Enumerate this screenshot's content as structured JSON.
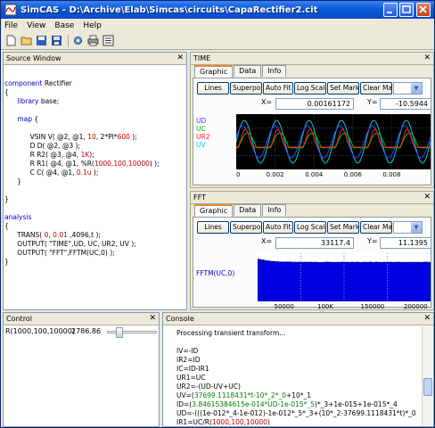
{
  "window": {
    "title": "SimCAS - D:\\Archive\\Elab\\Simcas\\circuits\\CapaRectifier2.cit",
    "controls": [
      "minimize",
      "maximize",
      "close"
    ]
  },
  "menu": [
    "File",
    "View",
    "Base",
    "Help"
  ],
  "toolbar": [
    "new-file-icon",
    "open-icon",
    "save-icon",
    "save-all-icon",
    "settings-icon",
    "print-icon",
    "list-icon"
  ],
  "source_window": {
    "title": "Source Window",
    "lines": [
      [
        {
          "t": "component ",
          "c": "kw"
        },
        {
          "t": "Rectifier"
        }
      ],
      [
        {
          "t": "{"
        }
      ],
      [
        {
          "t": "      "
        },
        {
          "t": "library ",
          "c": "kw"
        },
        {
          "t": "base;"
        }
      ],
      [
        {
          "t": ""
        }
      ],
      [
        {
          "t": "      "
        },
        {
          "t": "map ",
          "c": "kw"
        },
        {
          "t": "{"
        }
      ],
      [
        {
          "t": ""
        }
      ],
      [
        {
          "t": "            VSIN V( @2, @1, "
        },
        {
          "t": "10",
          "c": "nm"
        },
        {
          "t": ", 2*PI*"
        },
        {
          "t": "600",
          "c": "nm"
        },
        {
          "t": " );"
        }
      ],
      [
        {
          "t": "            D D( @2, @3 );"
        }
      ],
      [
        {
          "t": "            R R2( @3, @4, "
        },
        {
          "t": "1K",
          "c": "nm"
        },
        {
          "t": ");"
        }
      ],
      [
        {
          "t": "            R R1( @4, @1, %R("
        },
        {
          "t": "1000,100,10000",
          "c": "nm"
        },
        {
          "t": ") );"
        }
      ],
      [
        {
          "t": "            C C( @4, @1, "
        },
        {
          "t": "0.1u",
          "c": "nm"
        },
        {
          "t": " );"
        }
      ],
      [
        {
          "t": "      }"
        }
      ],
      [
        {
          "t": ""
        }
      ],
      [
        {
          "t": "}"
        }
      ],
      [
        {
          "t": ""
        }
      ],
      [
        {
          "t": "analysis",
          "c": "kw"
        }
      ],
      [
        {
          "t": "{"
        }
      ],
      [
        {
          "t": "      TRANS( "
        },
        {
          "t": "0",
          "c": "nm"
        },
        {
          "t": ", "
        },
        {
          "t": "0.01",
          "c": "nm"
        },
        {
          "t": " ,4096,t );"
        }
      ],
      [
        {
          "t": "      OUTPUT( \"TIME\",UD, UC, UR2, UV );"
        }
      ],
      [
        {
          "t": "      OUTPUT( \"FFT\",FFTM(UC,0) );"
        }
      ],
      [
        {
          "t": "}"
        }
      ]
    ]
  },
  "time_panel": {
    "title": "TIME",
    "tabs": [
      "Graphic",
      "Data",
      "Info"
    ],
    "active_tab": "Graphic",
    "buttons": [
      "Lines",
      "Superpose",
      "Auto Fit",
      "Log Scale",
      "Set Marker",
      "Clear Marker"
    ],
    "x_label": "X=",
    "x_value": "0.00161172",
    "y_label": "Y=",
    "y_value": "-10.5944",
    "legend": [
      {
        "name": "UD",
        "color": "#4040ff"
      },
      {
        "name": "UC",
        "color": "#00c000"
      },
      {
        "name": "UR2",
        "color": "#ff2020"
      },
      {
        "name": "UV",
        "color": "#00d0d0"
      }
    ],
    "x_ticks": [
      "0",
      "0.002",
      "0.004",
      "0.006",
      "0.008"
    ]
  },
  "fft_panel": {
    "title": "FFT",
    "tabs": [
      "Graphic",
      "Data",
      "Info"
    ],
    "active_tab": "Graphic",
    "buttons": [
      "Lines",
      "Superpose",
      "Auto Fit",
      "Log Scale",
      "Set Marker",
      "Clear Marker"
    ],
    "x_label": "X=",
    "x_value": "33117.4",
    "y_label": "Y=",
    "y_value": "11.1395",
    "legend": [
      {
        "name": "FFTM(UC,0)",
        "color": "#0000c0"
      }
    ],
    "x_ticks": [
      "50000",
      "100K",
      "150000",
      "200000"
    ]
  },
  "control": {
    "title": "Control",
    "param_label": "R(1000,100,10000)",
    "param_value": "2786.86",
    "slider_fraction": 0.19
  },
  "console": {
    "title": "Console",
    "lines": [
      [
        {
          "t": "Processing transient transform..."
        }
      ],
      [
        {
          "t": ""
        }
      ],
      [
        {
          "t": "IV=-ID"
        }
      ],
      [
        {
          "t": "IR2=ID"
        }
      ],
      [
        {
          "t": "IC=ID-IR1"
        }
      ],
      [
        {
          "t": "UR1=UC"
        }
      ],
      [
        {
          "t": "UR2=-(UD-UV+UC)"
        }
      ],
      [
        {
          "t": "UV=("
        },
        {
          "t": "37699.1118431*t-10*_2*_0",
          "c": "cgreen"
        },
        {
          "t": "+10*_1"
        }
      ],
      [
        {
          "t": "ID=("
        },
        {
          "t": "3.84615384615e-014*UD-1e-015*_5",
          "c": "cgreen"
        },
        {
          "t": ")*_3+1e-015+1e-015*_4"
        }
      ],
      [
        {
          "t": "UD=-(((1e-012*_4-1e-012)-1e-012*_5*_3+(10*_2-37699.1118431*t)*_0"
        }
      ],
      [
        {
          "t": "IR1=UC/R("
        },
        {
          "t": "1000,100,10000",
          "c": "cred"
        },
        {
          "t": ")"
        }
      ]
    ]
  }
}
